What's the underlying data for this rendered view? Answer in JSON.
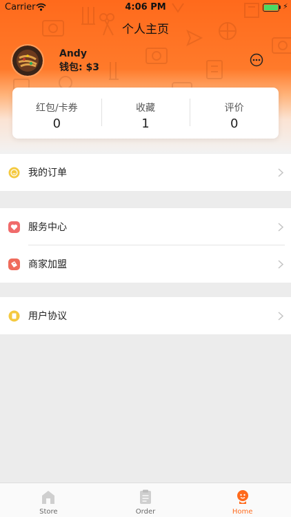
{
  "status_bar": {
    "carrier": "Carrier",
    "time": "4:06 PM"
  },
  "header": {
    "title": "个人主页"
  },
  "user": {
    "name": "Andy",
    "wallet": "钱包: $3"
  },
  "stats": [
    {
      "label": "红包/卡券",
      "value": "0"
    },
    {
      "label": "收藏",
      "value": "1"
    },
    {
      "label": "评价",
      "value": "0"
    }
  ],
  "menu": {
    "orders": {
      "label": "我的订单",
      "icon": "order-face-icon",
      "color": "#f4c93f"
    },
    "service": {
      "label": "服务中心",
      "icon": "heart-icon",
      "color": "#f06b6b"
    },
    "merchant": {
      "label": "商家加盟",
      "icon": "tag-icon",
      "color": "#ef6b5b"
    },
    "agreement": {
      "label": "用户协议",
      "icon": "document-icon",
      "color": "#f4c93f"
    }
  },
  "tabbar": {
    "active_color": "#ff6a1c",
    "tabs": [
      {
        "label": "Store",
        "icon": "store-icon"
      },
      {
        "label": "Order",
        "icon": "clipboard-icon"
      },
      {
        "label": "Home",
        "icon": "home-person-icon"
      }
    ]
  },
  "colors": {
    "accent": "#ff6a1c",
    "background": "#ececec"
  }
}
